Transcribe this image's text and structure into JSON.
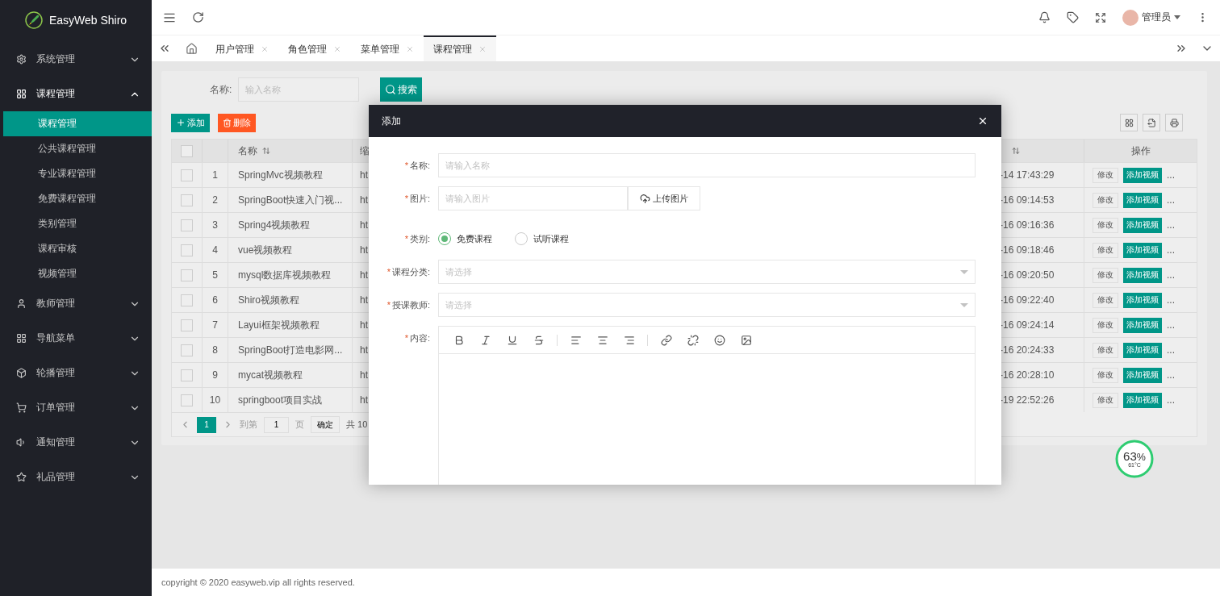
{
  "sidebar": {
    "logo": "EasyWeb Shiro",
    "items": [
      {
        "kind": "gear",
        "label": "系统管理",
        "expanded": false
      },
      {
        "kind": "grid",
        "label": "课程管理",
        "expanded": true,
        "children": [
          {
            "label": "课程管理",
            "selected": true
          },
          {
            "label": "公共课程管理",
            "selected": false
          },
          {
            "label": "专业课程管理",
            "selected": false
          },
          {
            "label": "免费课程管理",
            "selected": false
          },
          {
            "label": "类别管理",
            "selected": false
          },
          {
            "label": "课程审核",
            "selected": false
          },
          {
            "label": "视频管理",
            "selected": false
          }
        ]
      },
      {
        "kind": "user",
        "label": "教师管理",
        "expanded": false
      },
      {
        "kind": "grid",
        "label": "导航菜单",
        "expanded": false
      },
      {
        "kind": "cube",
        "label": "轮播管理",
        "expanded": false
      },
      {
        "kind": "cart",
        "label": "订单管理",
        "expanded": false
      },
      {
        "kind": "speaker",
        "label": "通知管理",
        "expanded": false
      },
      {
        "kind": "star",
        "label": "礼品管理",
        "expanded": false
      }
    ]
  },
  "header": {
    "user": "管理员"
  },
  "tabs": [
    {
      "kind": "home",
      "selected": false
    },
    {
      "kind": "page",
      "label": "用户管理",
      "selected": false
    },
    {
      "kind": "page",
      "label": "角色管理",
      "selected": false
    },
    {
      "kind": "page",
      "label": "菜单管理",
      "selected": false
    },
    {
      "kind": "page",
      "label": "课程管理",
      "selected": true
    }
  ],
  "search": {
    "label": "名称:",
    "placeholder": "输入名称",
    "button": "搜索"
  },
  "toolbar": {
    "add": "添加",
    "delete": "删除"
  },
  "table": {
    "all_checked": false,
    "columns": [
      {
        "label": "名称",
        "sortable": true
      },
      {
        "label": "缩"
      },
      {
        "sortable": true
      },
      {
        "label": "操作",
        "sortable": false
      }
    ],
    "rows": [
      {
        "checked": false,
        "index": "1",
        "name": "SpringMvc视频教程",
        "column_4": "ht",
        "time": "-14 17:43:29",
        "edit": "修改",
        "add_video": "添加视频",
        "more": "..."
      },
      {
        "checked": false,
        "index": "2",
        "name": "SpringBoot快速入门视...",
        "column_4": "ht",
        "time": "-16 09:14:53",
        "edit": "修改",
        "add_video": "添加视频",
        "more": "..."
      },
      {
        "checked": false,
        "index": "3",
        "name": "Spring4视频教程",
        "column_4": "ht",
        "time": "-16 09:16:36",
        "edit": "修改",
        "add_video": "添加视频",
        "more": "..."
      },
      {
        "checked": false,
        "index": "4",
        "name": "vue视频教程",
        "column_4": "ht",
        "time": "-16 09:18:46",
        "edit": "修改",
        "add_video": "添加视频",
        "more": "..."
      },
      {
        "checked": false,
        "index": "5",
        "name": "mysql数据库视频教程",
        "column_4": "ht",
        "time": "-16 09:20:50",
        "edit": "修改",
        "add_video": "添加视频",
        "more": "..."
      },
      {
        "checked": false,
        "index": "6",
        "name": "Shiro视频教程",
        "column_4": "ht",
        "time": "-16 09:22:40",
        "edit": "修改",
        "add_video": "添加视频",
        "more": "..."
      },
      {
        "checked": false,
        "index": "7",
        "name": "Layui框架视频教程",
        "column_4": "ht",
        "time": "-16 09:24:14",
        "edit": "修改",
        "add_video": "添加视频",
        "more": "..."
      },
      {
        "checked": false,
        "index": "8",
        "name": "SpringBoot打造电影网...",
        "column_4": "ht",
        "time": "-16 20:24:33",
        "edit": "修改",
        "add_video": "添加视频",
        "more": "..."
      },
      {
        "checked": false,
        "index": "9",
        "name": "mycat视频教程",
        "column_4": "ht",
        "time": "-16 20:28:10",
        "edit": "修改",
        "add_video": "添加视频",
        "more": "..."
      },
      {
        "checked": false,
        "index": "10",
        "name": "springboot项目实战",
        "column_4": "ht",
        "time": "-19 22:52:26",
        "edit": "修改",
        "add_video": "添加视频",
        "more": "..."
      }
    ]
  },
  "pagination": {
    "current": "1",
    "goto": "到第",
    "page_value": "1",
    "page_unit": "页",
    "confirm": "确定",
    "total": "共 10"
  },
  "dialog": {
    "title": "添加",
    "fields": [
      {
        "kind": "text",
        "required_mark": "*",
        "label": "名称:",
        "placeholder": "请输入名称"
      },
      {
        "kind": "upload",
        "required_mark": "*",
        "label": "图片:",
        "placeholder": "请输入图片",
        "button": "上传图片"
      },
      {
        "kind": "radio",
        "required_mark": "*",
        "label": "类别:",
        "options": [
          {
            "label": "免费课程",
            "selected": true
          },
          {
            "label": "试听课程",
            "selected": false
          }
        ]
      },
      {
        "kind": "select",
        "required_mark": "*",
        "label": "课程分类:",
        "placeholder": "请选择"
      },
      {
        "kind": "select",
        "required_mark": "*",
        "label": "授课教师:",
        "placeholder": "请选择"
      },
      {
        "kind": "editor",
        "required_mark": "*",
        "label": "内容:"
      }
    ]
  },
  "monitor": {
    "percent": "63",
    "unit": "%",
    "temperature": "61°C"
  },
  "footer": "copyright © 2020 easyweb.vip all rights reserved."
}
